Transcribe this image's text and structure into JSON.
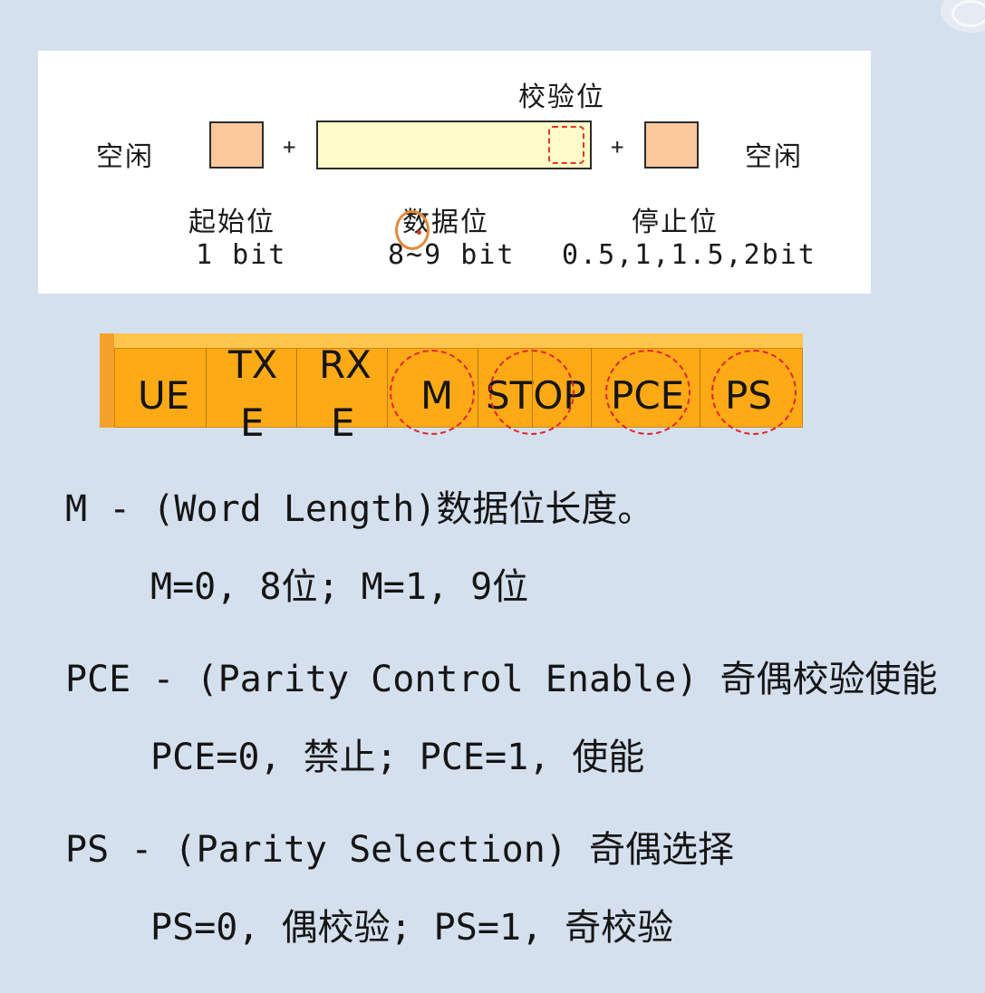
{
  "frame": {
    "idle_left": "空闲",
    "idle_right": "空闲",
    "parity_label": "校验位",
    "plus": "+",
    "start_label": "起始位",
    "start_size": "1 bit",
    "data_label": "数据位",
    "data_size": "8~9 bit",
    "stop_label": "停止位",
    "stop_size": "0.5,1,1.5,2bit",
    "colors": {
      "start_stop_fill": "#fac89a",
      "data_fill": "#fffbc8",
      "parity_dash": "#e3352a"
    }
  },
  "register": {
    "fields": [
      {
        "l1": "UE",
        "l2": "",
        "highlighted": false
      },
      {
        "l1": "TX",
        "l2": "E",
        "highlighted": false
      },
      {
        "l1": "RX",
        "l2": "E",
        "highlighted": false
      },
      {
        "l1": "M",
        "l2": "",
        "highlighted": true
      },
      {
        "l1": "STOP",
        "l2": "",
        "highlighted": true
      },
      {
        "l1": "PCE",
        "l2": "",
        "highlighted": true
      },
      {
        "l1": "PS",
        "l2": "",
        "highlighted": true
      }
    ],
    "colors": {
      "fill": "#fdaa16",
      "highlight_circle": "#e3232a"
    }
  },
  "descriptions": [
    {
      "title": "M - (Word Length)数据位长度。",
      "detail": "M=0, 8位; M=1, 9位"
    },
    {
      "title": "PCE - (Parity Control Enable) 奇偶校验使能",
      "detail": "PCE=0, 禁止; PCE=1, 使能"
    },
    {
      "title": "PS - (Parity Selection) 奇偶选择",
      "detail": "PS=0, 偶校验; PS=1, 奇校验"
    }
  ]
}
